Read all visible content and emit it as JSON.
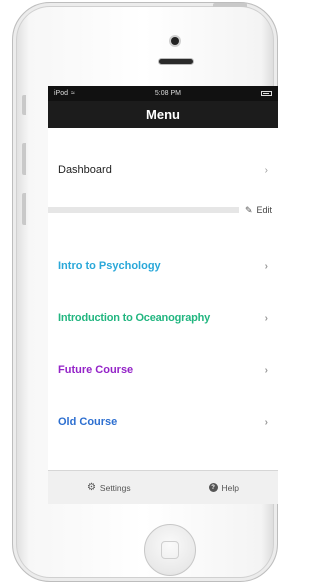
{
  "status_bar": {
    "carrier": "iPod",
    "wifi_icon": "wifi-icon",
    "time": "5:08 PM",
    "battery_icon": "battery-icon"
  },
  "nav": {
    "title": "Menu"
  },
  "menu": {
    "dashboard_label": "Dashboard",
    "edit_label": "Edit",
    "courses": [
      {
        "label": "Intro to Psychology",
        "color": "#2aa8d9"
      },
      {
        "label": "Introduction to Oceanography",
        "color": "#22b680"
      },
      {
        "label": "Future Course",
        "color": "#9423c8"
      },
      {
        "label": "Old Course",
        "color": "#2d6fd0"
      }
    ]
  },
  "tabbar": {
    "settings_label": "Settings",
    "help_label": "Help"
  }
}
